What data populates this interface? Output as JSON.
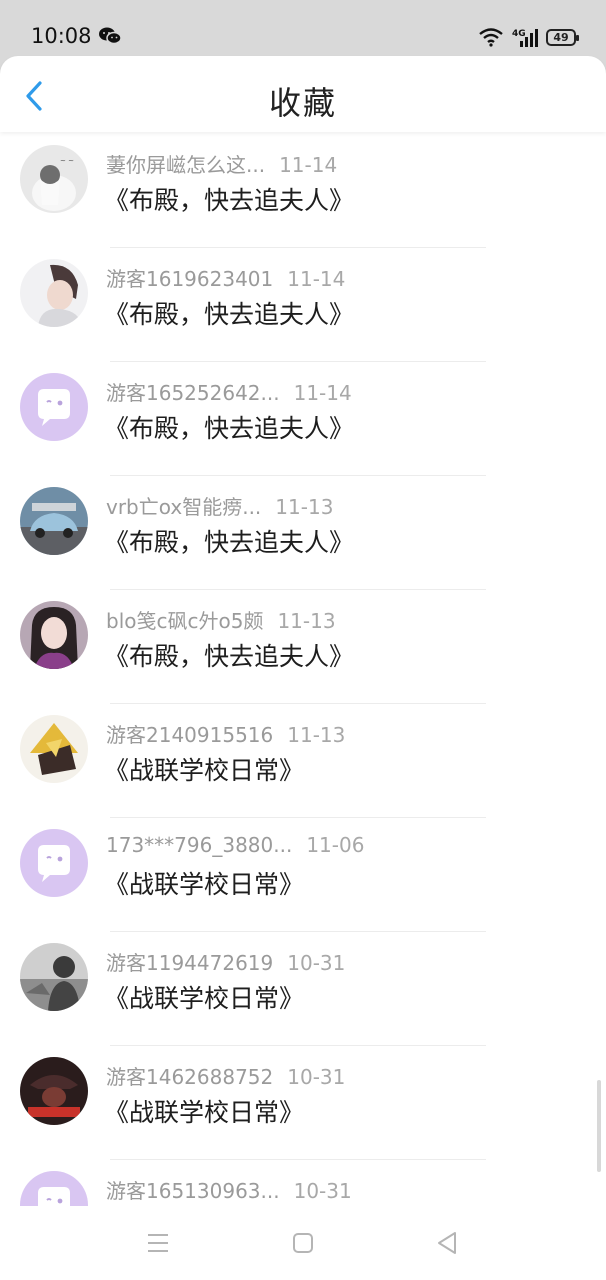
{
  "status": {
    "time": "10:08",
    "battery": "49",
    "network": "4G"
  },
  "header": {
    "title": "收藏"
  },
  "items": [
    {
      "user": "萋你屏嵫怎么这...",
      "date": "11-14",
      "book": "《布殿，快去追夫人》"
    },
    {
      "user": "游客1619623401",
      "date": "11-14",
      "book": "《布殿，快去追夫人》"
    },
    {
      "user": "游客165252642...",
      "date": "11-14",
      "book": "《布殿，快去追夫人》"
    },
    {
      "user": "vrb亡ox智能痨...",
      "date": "11-13",
      "book": "《布殿，快去追夫人》"
    },
    {
      "user": "blo笺c砜c㚈o5颇",
      "date": "11-13",
      "book": "《布殿，快去追夫人》"
    },
    {
      "user": "游客2140915516",
      "date": "11-13",
      "book": "《战联学校日常》"
    },
    {
      "user": "173***796_3880...",
      "date": "11-06",
      "book": "《战联学校日常》"
    },
    {
      "user": "游客1194472619",
      "date": "10-31",
      "book": "《战联学校日常》"
    },
    {
      "user": "游客1462688752",
      "date": "10-31",
      "book": "《战联学校日常》"
    },
    {
      "user": "游客165130963...",
      "date": "10-31",
      "book": ""
    }
  ],
  "colors": {
    "accent": "#2f9bea",
    "default_avatar": "#d9c6f2"
  }
}
